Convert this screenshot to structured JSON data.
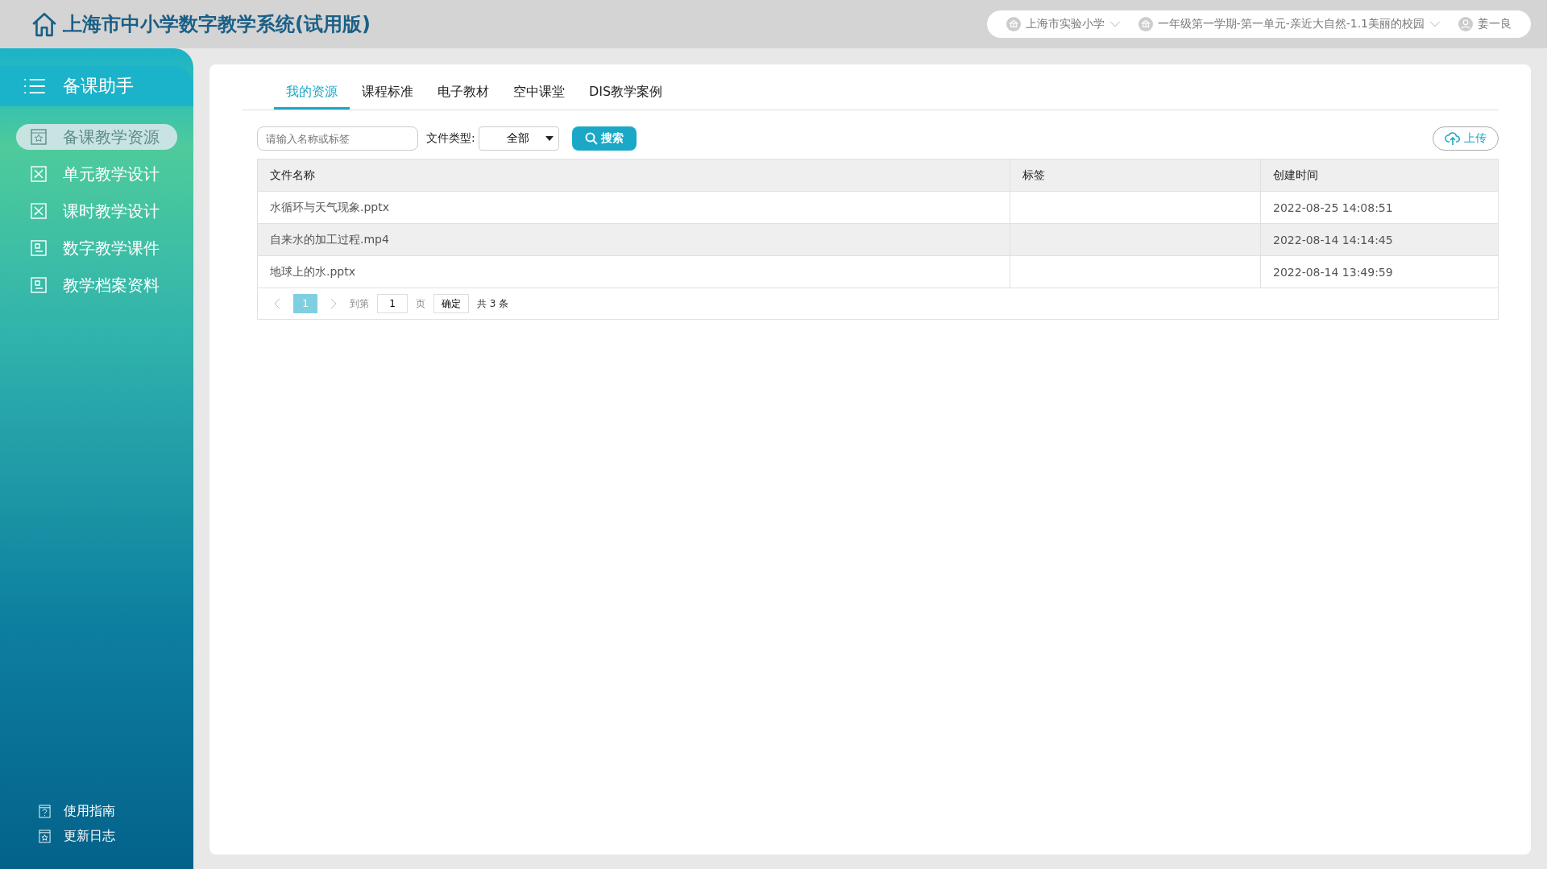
{
  "header": {
    "title": "上海市中小学数字教学系统(试用版)",
    "school": "上海市实验小学",
    "lesson": "一年级第一学期-第一单元-亲近大自然-1.1美丽的校园",
    "user": "姜一良"
  },
  "sidebar": {
    "title": "备课助手",
    "items": [
      {
        "label": "备课教学资源",
        "kind": "star",
        "selected": true
      },
      {
        "label": "单元教学设计",
        "kind": "design",
        "selected": false
      },
      {
        "label": "课时教学设计",
        "kind": "design",
        "selected": false
      },
      {
        "label": "数字教学课件",
        "kind": "doc",
        "selected": false
      },
      {
        "label": "教学档案资料",
        "kind": "doc",
        "selected": false
      }
    ],
    "footer": [
      {
        "label": "使用指南",
        "kind": "help"
      },
      {
        "label": "更新日志",
        "kind": "star"
      }
    ]
  },
  "tabs": [
    {
      "label": "我的资源",
      "selected": true
    },
    {
      "label": "课程标准",
      "selected": false
    },
    {
      "label": "电子教材",
      "selected": false
    },
    {
      "label": "空中课堂",
      "selected": false
    },
    {
      "label": "DIS教学案例",
      "selected": false
    }
  ],
  "toolbar": {
    "search_placeholder": "请输入名称或标签",
    "type_label": "文件类型:",
    "type_value": "全部",
    "search_button": "搜索",
    "upload_button": "上传"
  },
  "table": {
    "columns": [
      "文件名称",
      "标签",
      "创建时间"
    ],
    "rows": [
      {
        "cells": [
          "水循环与天气现象.pptx",
          "",
          "2022-08-25 14:08:51"
        ],
        "selected": false
      },
      {
        "cells": [
          "自来水的加工过程.mp4",
          "",
          "2022-08-14 14:14:45"
        ],
        "selected": true
      },
      {
        "cells": [
          "地球上的水.pptx",
          "",
          "2022-08-14 13:49:59"
        ],
        "selected": false
      }
    ]
  },
  "pagination": {
    "current": "1",
    "goto_label": "到第",
    "goto_value": "1",
    "page_unit": "页",
    "confirm": "确定",
    "total": "共 3 条"
  }
}
